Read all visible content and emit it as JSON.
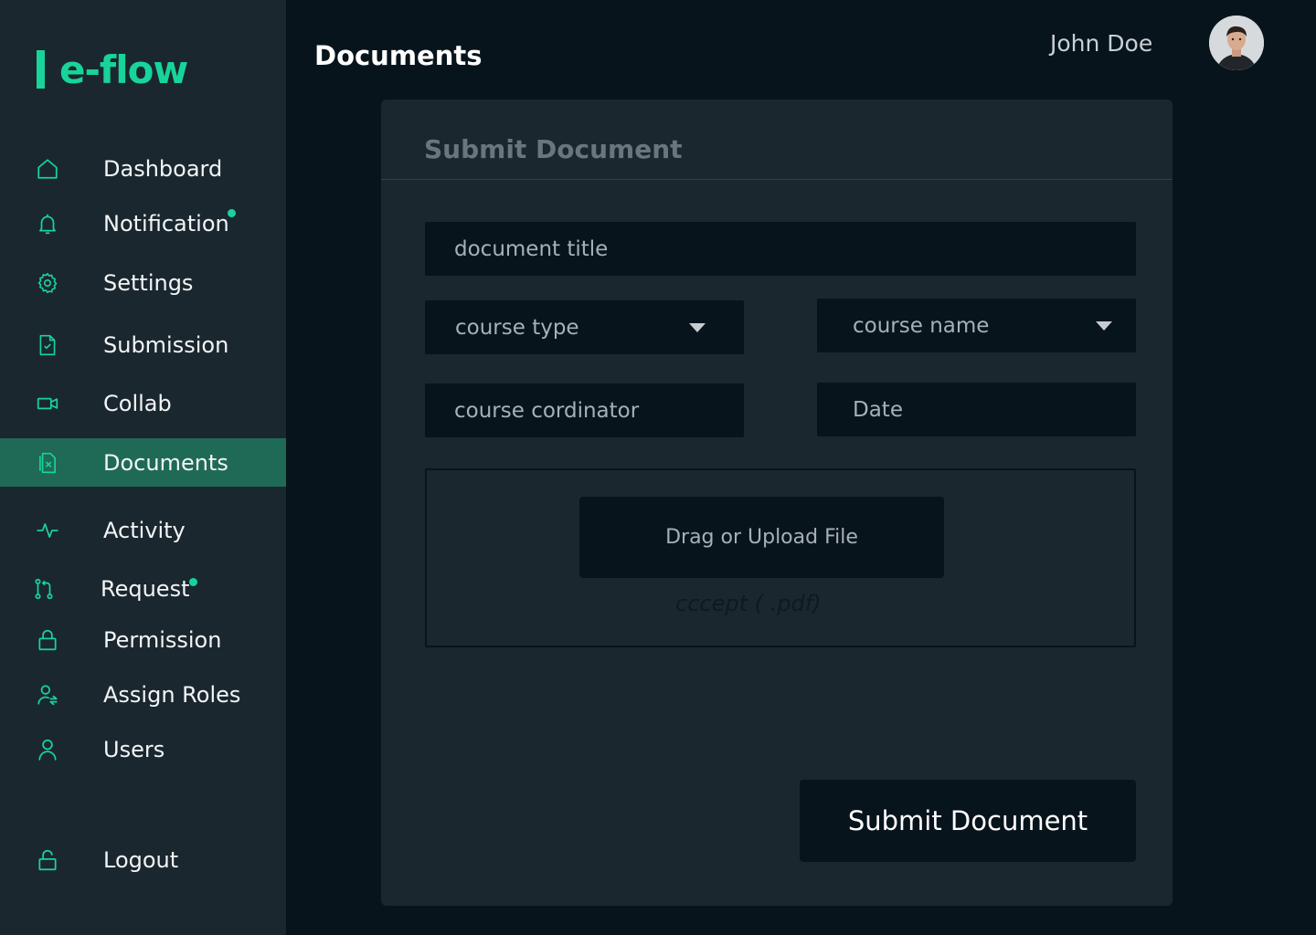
{
  "brand": {
    "logo_text": "e-flow",
    "accent": "#18d49a"
  },
  "header": {
    "title": "Documents",
    "user_name": "John Doe"
  },
  "sidebar": {
    "items": [
      {
        "label": "Dashboard",
        "icon": "home-icon",
        "badge": false,
        "active": false
      },
      {
        "label": "Notification",
        "icon": "bell-icon",
        "badge": true,
        "active": false
      },
      {
        "label": "Settings",
        "icon": "gear-icon",
        "badge": false,
        "active": false
      },
      {
        "label": "Submission",
        "icon": "file-check-icon",
        "badge": false,
        "active": false
      },
      {
        "label": "Collab",
        "icon": "video-icon",
        "badge": false,
        "active": false
      },
      {
        "label": "Documents",
        "icon": "file-x-icon",
        "badge": false,
        "active": true
      },
      {
        "label": "Activity",
        "icon": "activity-icon",
        "badge": false,
        "active": false
      },
      {
        "label": "Request",
        "icon": "git-pull-icon",
        "badge": true,
        "active": false
      },
      {
        "label": "Permission",
        "icon": "lock-icon",
        "badge": false,
        "active": false
      },
      {
        "label": "Assign Roles",
        "icon": "user-roles-icon",
        "badge": false,
        "active": false
      },
      {
        "label": "Users",
        "icon": "user-icon",
        "badge": false,
        "active": false
      }
    ],
    "logout": {
      "label": "Logout",
      "icon": "unlock-icon"
    }
  },
  "form": {
    "title": "Submit Document",
    "document_title_placeholder": "document title",
    "course_type_placeholder": "course type",
    "course_name_placeholder": "course name",
    "course_coordinator_placeholder": "course cordinator",
    "date_placeholder": "Date",
    "upload_label": "Drag or Upload File",
    "accept_hint": "cccept ( .pdf)",
    "submit_label": "Submit Document"
  },
  "colors": {
    "page_bg": "#08141c",
    "panel_bg": "#1b272f",
    "active_nav_bg": "#1f6a56"
  }
}
